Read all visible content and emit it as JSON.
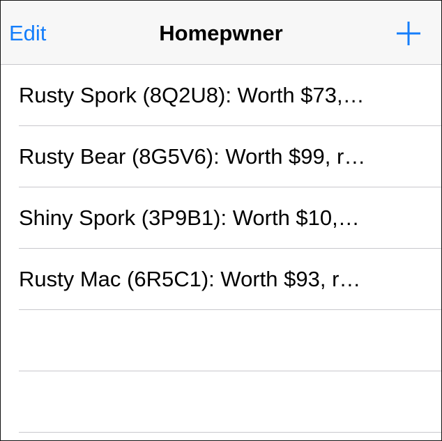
{
  "navbar": {
    "edit_label": "Edit",
    "title": "Homepwner",
    "add_icon": "plus-icon",
    "accent_color": "#157efb"
  },
  "items": [
    {
      "label": "Rusty Spork (8Q2U8): Worth $73,…"
    },
    {
      "label": "Rusty Bear (8G5V6): Worth $99, r…"
    },
    {
      "label": "Shiny Spork (3P9B1): Worth $10,…"
    },
    {
      "label": "Rusty Mac (6R5C1): Worth $93, r…"
    }
  ]
}
